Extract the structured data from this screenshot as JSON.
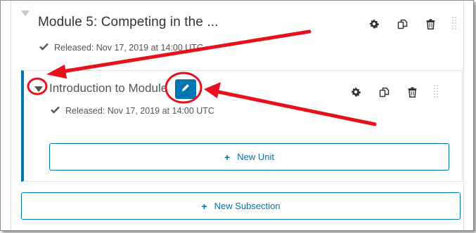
{
  "section": {
    "title": "Module 5: Competing in the ...",
    "released": "Released: Nov 17, 2019 at 14:00 UTC",
    "new_subsection_label": "New Subsection"
  },
  "subsection": {
    "title": "Introduction to Module",
    "released": "Released: Nov 17, 2019 at 14:00 UTC",
    "new_unit_label": "New Unit"
  },
  "icons": {
    "settings": "gear-icon",
    "duplicate": "copy-icon",
    "delete": "trash-icon",
    "drag": "drag-handle-icon",
    "edit": "pencil-icon",
    "released": "check-icon",
    "add": "plus-icon"
  },
  "colors": {
    "accent": "#0075b4",
    "annotation": "#e8101c",
    "text": "#333333"
  }
}
